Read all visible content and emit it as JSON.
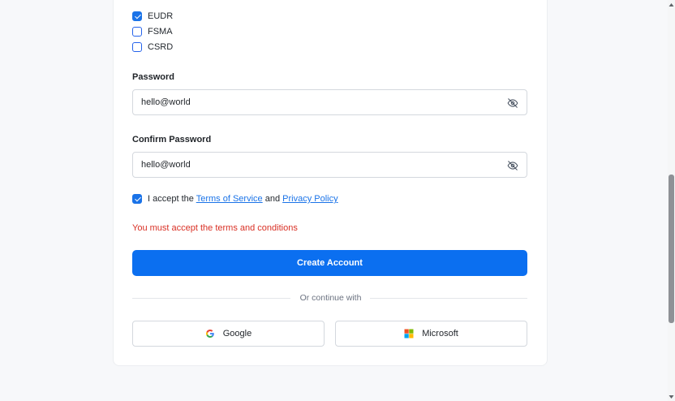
{
  "regulations": {
    "options": [
      {
        "label": "EUDR",
        "checked": true
      },
      {
        "label": "FSMA",
        "checked": false
      },
      {
        "label": "CSRD",
        "checked": false
      }
    ]
  },
  "password": {
    "label": "Password",
    "value": "hello@world",
    "toggle_icon": "eye-off-icon"
  },
  "confirm_password": {
    "label": "Confirm Password",
    "value": "hello@world",
    "toggle_icon": "eye-off-icon"
  },
  "terms": {
    "checked": true,
    "prefix": "I accept the",
    "terms_link": "Terms of Service",
    "and": "and",
    "privacy_link": "Privacy Policy"
  },
  "error_message": "You must accept the terms and conditions",
  "create_button": "Create Account",
  "divider": "Or continue with",
  "social": {
    "google": {
      "label": "Google",
      "icon": "google-icon"
    },
    "microsoft": {
      "label": "Microsoft",
      "icon": "microsoft-icon"
    }
  },
  "colors": {
    "primary": "#0b6ff0",
    "link": "#1a73e8",
    "error": "#d93025"
  }
}
